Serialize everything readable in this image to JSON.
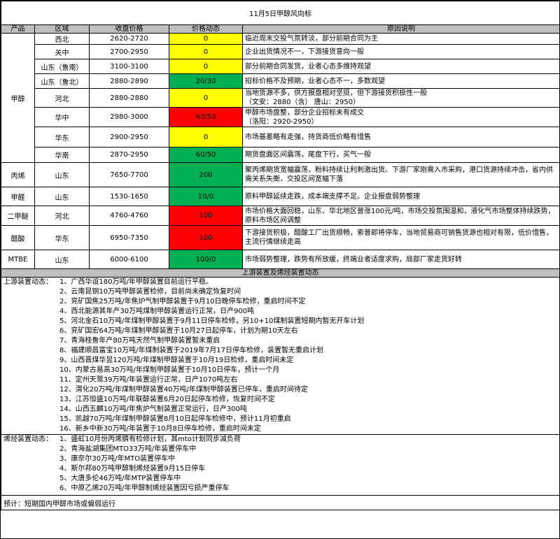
{
  "title": "11月5日甲醇风向标",
  "headers": {
    "product": "产品",
    "region": "区域",
    "price": "收盘价格",
    "change": "价格动态",
    "reason": "原因说明"
  },
  "methanol": {
    "product": "甲醇",
    "rows": [
      {
        "region": "西北",
        "price": "2620-2720",
        "change": "0",
        "color": "#ffff00",
        "reason": "临近周末交投气氛转淡，部分前期合同为主"
      },
      {
        "region": "关中",
        "price": "2700-2950",
        "change": "0",
        "color": "#ffff00",
        "reason": "企业出货情况不一，下游接货意向一般"
      },
      {
        "region": "山东（鲁南）",
        "price": "3100-3100",
        "change": "0",
        "color": "#ffff00",
        "reason": "部分前期合同发货，业者心态多维持观望"
      },
      {
        "region": "山东（鲁北）",
        "price": "2880-2890",
        "change": "20/30",
        "color": "#00b050",
        "reason": "招标价格不及预期，业者心态不一，多数观望"
      },
      {
        "region": "河北",
        "price": "2880-2880",
        "change": "0",
        "color": "#ffff00",
        "reason": "当地货源不多，供方报盘相对坚挺，但下游接货积极性一般",
        "reason2": "（文安：2880（含）  唐山：2950）"
      },
      {
        "region": "华中",
        "price": "2980-3000",
        "change": "60/50",
        "color": "#ff0000",
        "reason": "甲醇市场盘整，部分企业招标未有成交",
        "reason2": "（洛阳：2920-2950）"
      },
      {
        "region": "华东",
        "price": "2900-2950",
        "change": "0",
        "color": "#ffff00",
        "reason": "市场基差略有走强，持货商低价略有惜售"
      },
      {
        "region": "华南",
        "price": "2870-2950",
        "change": "60/50",
        "color": "#00b050",
        "reason": "期货盘面区间震荡，尾盘下行，买气一般"
      }
    ]
  },
  "others": [
    {
      "product": "丙烯",
      "region": "山东",
      "price": "7650-7700",
      "change": "200",
      "color": "#00b050",
      "reason": "聚丙烯期货宽幅震荡，粉料持续让利刺激出货。下游厂家刚需入市采购，港口货源持续冲击，省内供需关系失衡，交投区间宽幅下落"
    },
    {
      "product": "甲醛",
      "region": "山东",
      "price": "1530-1650",
      "change": "10/0",
      "color": "#00b050",
      "reason": "原料甲醇延续走跌，成本端支撑不足。企业报盘弱势整理"
    },
    {
      "product": "二甲醚",
      "region": "河北",
      "price": "4760-4760",
      "change": "100",
      "color": "#ff0000",
      "reason": "市场价格大面回稳，山东、华北地区普涨100元/吨，市场交投氛围温和，液化气市场整体持续跌势，原料市场区间调整"
    },
    {
      "product": "醋酸",
      "region": "华东",
      "price": "6950-7350",
      "change": "100",
      "color": "#ff0000",
      "reason": "下游接货积极，醋酸工厂出货顺畅，索普即将停车，当地贸易商可销售货源也相对有限，低价惜售，主流行情继续走高"
    },
    {
      "product": "MTBE",
      "region": "山东",
      "price": "6000-6100",
      "change": "100/0",
      "color": "#00b050",
      "reason": "市场弱势整理，跌势有所放缓，终端业者适度求购，局部厂家走货好转"
    }
  ],
  "section_title": "上游装置及烯烃装置动态",
  "upstream": {
    "label": "上游装置动态：",
    "items": [
      "1、广西华谊180万吨/年甲醇装置目前运行平稳。",
      "2、云南昆钢10万吨甲醇装置检修，目前尚未确定恢复时间",
      "2、兖矿国焦25万吨/年焦炉气制甲醇装置于9月10日晚停车检修，重启时间不定",
      "4、西北能源其年产30万吨煤制甲醇装置运行正常，日产900吨",
      "5、河北金石10万吨/年煤制甲醇装置于9月11日停车检修，另10+10煤制装置短期内暂无开车计划",
      "6、兖矿国宏64万吨/年煤制甲醇装置于10月27日起停车，计划为期10天左右",
      "7、青海桂鲁年产80万吨天然气制甲醇装置暂未重启",
      "8、福建顺昌富宝10万吨/年煤制装置于2019年7月17日停车检修，装置暂无重启计划",
      "9、山西晋煤华昱120万吨/年煤制甲醇装置于10月19日检修，重启时间未定",
      "10、内蒙古易高30万吨/年煤制甲醇装置于10月10日停车，预计一个月",
      "11、定州天鹭39万吨/年装置运行正常，日产1070吨左右",
      "12、渭化20万吨/年煤制甲醇装置40万吨/年煤制甲醇装置已停车，重启时间待定",
      "13、江苏恒盛10万吨/年联醇装置6月20日起停车检修，恢复时间不定",
      "14、山西五麟10万吨/年焦炉气制装置正常运行，日产300吨",
      "15、凯越70万吨/年煤制甲醇装置8月10日起停车检修中，预计11月初重启",
      "16、新乡中新30万吨/年装置于10月8日停车检修，重启时间未定"
    ]
  },
  "olefin": {
    "label": "烯烃装置动态：",
    "items": [
      "1、盛虹10月份丙烯腈有检修计划，其mto计划同步减负荷",
      "2、青海盐湖集团MTO33万吨/年装置停车中",
      "3、康奈尔30万吨/年MTO装置停车中",
      "4、斯尔邦80万吨甲醇制烯烃装置9月15日停车",
      "5、大唐多伦46万吨/年MTP装置停车中",
      "6、中原乙烯20万吨/年甲醇制烯烃装置因亏损严重停车"
    ]
  },
  "forecast": "预计：短期国内甲醇市场或偏弱运行"
}
